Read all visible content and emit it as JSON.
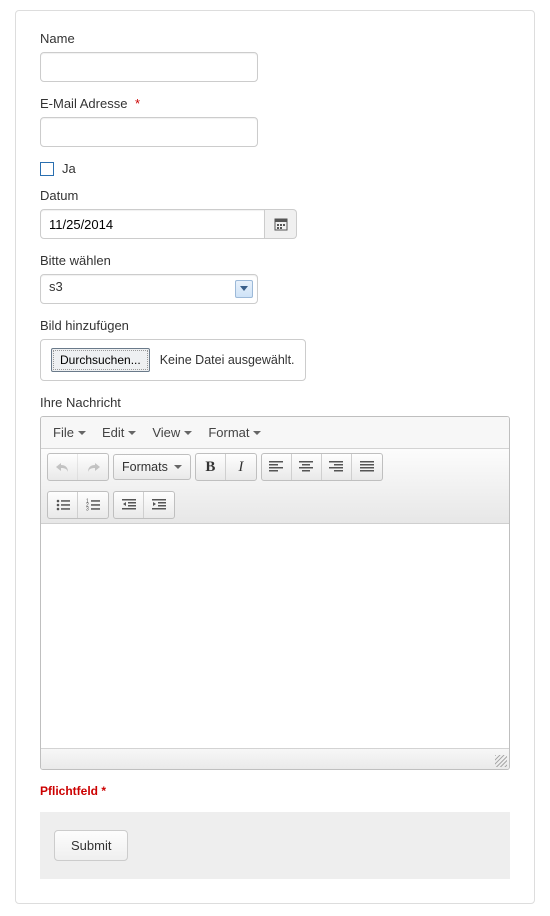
{
  "fields": {
    "name_label": "Name",
    "email_label": "E-Mail Adresse",
    "ja_label": "Ja",
    "datum_label": "Datum",
    "datum_value": "11/25/2014",
    "select_label": "Bitte wählen",
    "select_value": "s3",
    "file_label": "Bild hinzufügen",
    "file_button": "Durchsuchen...",
    "file_status": "Keine Datei ausgewählt.",
    "message_label": "Ihre Nachricht",
    "required_asterisk": "*"
  },
  "editor": {
    "menu": {
      "file": "File",
      "edit": "Edit",
      "view": "View",
      "format": "Format"
    },
    "formats_label": "Formats"
  },
  "footer": {
    "pflicht": "Pflichtfeld *",
    "submit": "Submit"
  }
}
